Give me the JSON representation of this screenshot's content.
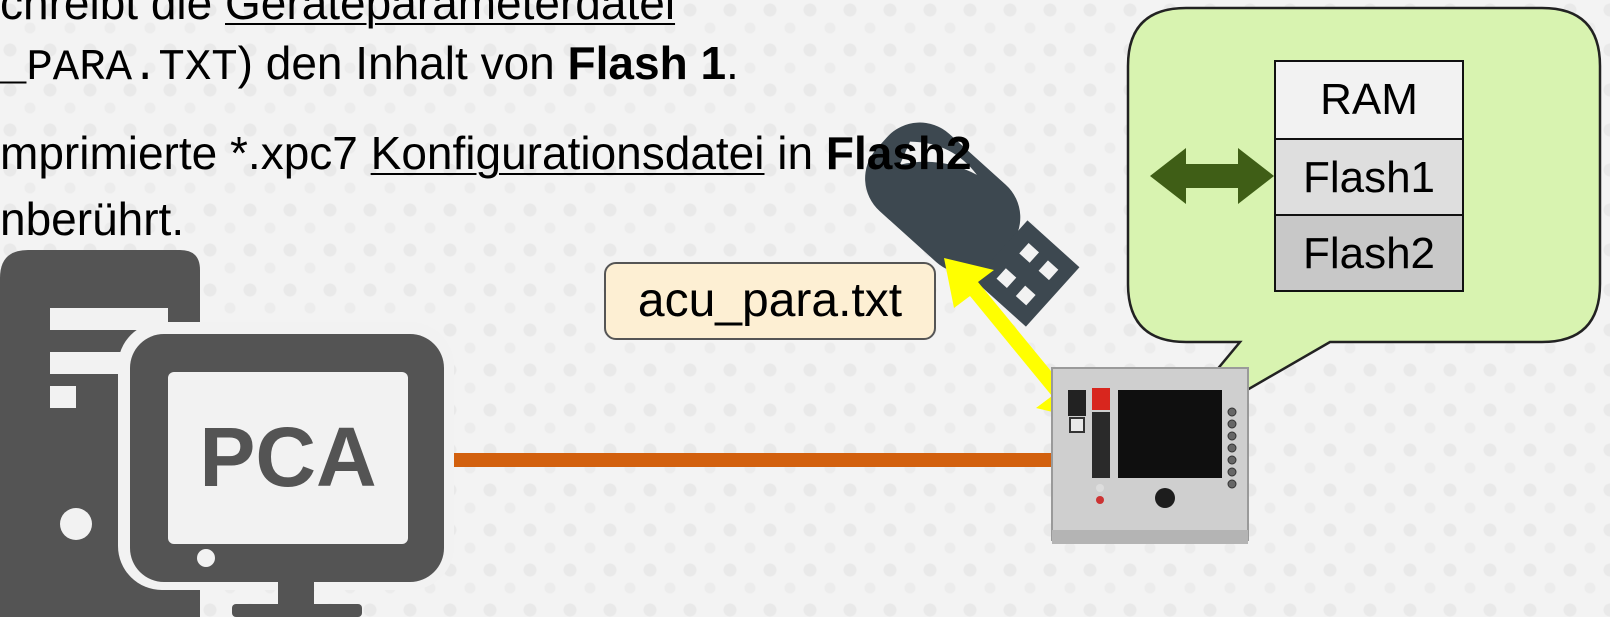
{
  "text": {
    "line1_pre": "chreibt die ",
    "line1_link": "Geräteparameterdatei",
    "line2_mono": "_PARA.TXT",
    "line2_post": ") den Inhalt von ",
    "line2_bold": "Flash 1",
    "line2_end": ".",
    "line3_pre": "mprimierte *.xpc7 ",
    "line3_link": "Konfigurationsdatei",
    "line3_mid": " in ",
    "line3_bold": "Flash2",
    "line4": "nberührt."
  },
  "computer": {
    "label": "PCA"
  },
  "file": {
    "label": "acu_para.txt"
  },
  "memory": {
    "cells": [
      "RAM",
      "Flash1",
      "Flash2"
    ]
  },
  "colors": {
    "cable": "#d2600e",
    "transfer_arrow": "#ffff00",
    "memory_arrow": "#3f5e16",
    "callout_fill": "#d8f3b0",
    "file_label_fill": "#fdefd3",
    "memory_cell_fills": [
      "#f2f2f2",
      "#dedede",
      "#c8c8c8"
    ],
    "computer_icon": "#545454"
  },
  "icons": [
    "computer-icon",
    "usb-stick-icon",
    "device-icon"
  ]
}
